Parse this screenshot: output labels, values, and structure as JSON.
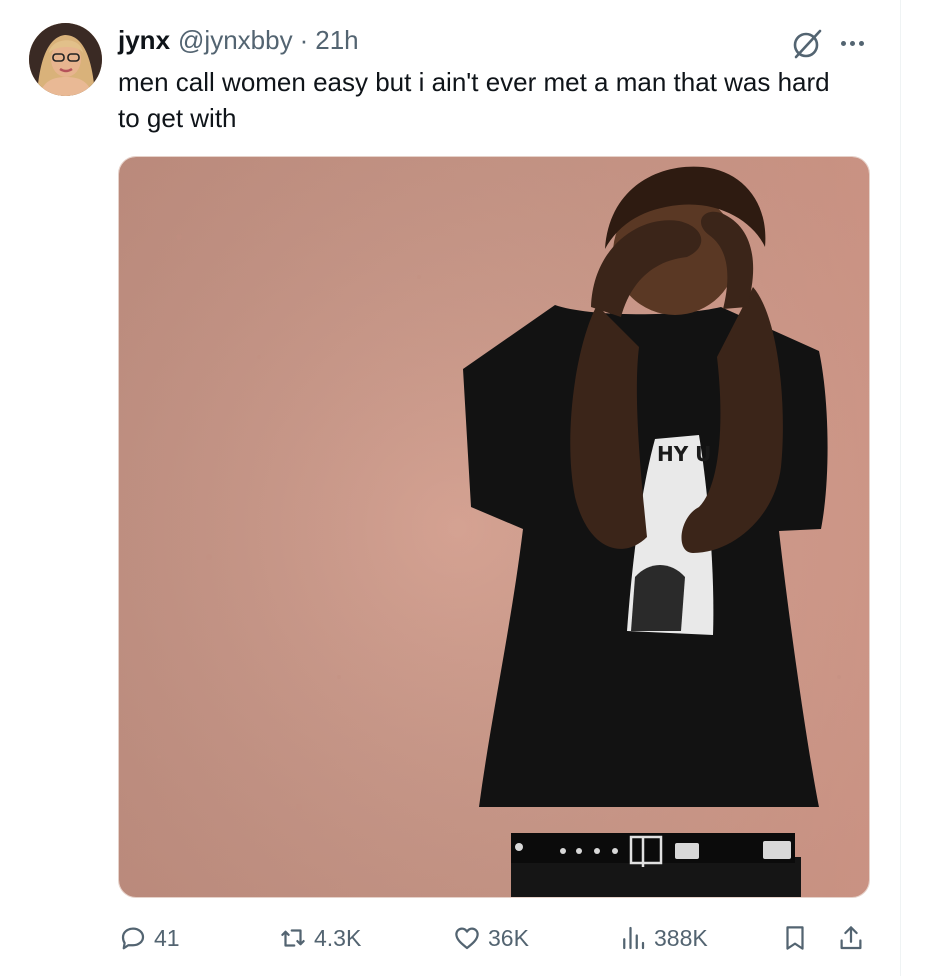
{
  "tweet": {
    "display_name": "jynx",
    "handle": "@jynxbby",
    "separator": "·",
    "time": "21h",
    "text": "men call women easy but i ain't ever met a man that was hard to get with"
  },
  "header_icons": [
    "grok-icon",
    "more-icon"
  ],
  "media": {
    "shirt_print_text": "HY U"
  },
  "actions": {
    "reply_count": "41",
    "repost_count": "4.3K",
    "like_count": "36K",
    "view_count": "388K"
  },
  "colors": {
    "text_primary": "#0f1419",
    "text_secondary": "#536471",
    "wall": "#d49f8f"
  }
}
